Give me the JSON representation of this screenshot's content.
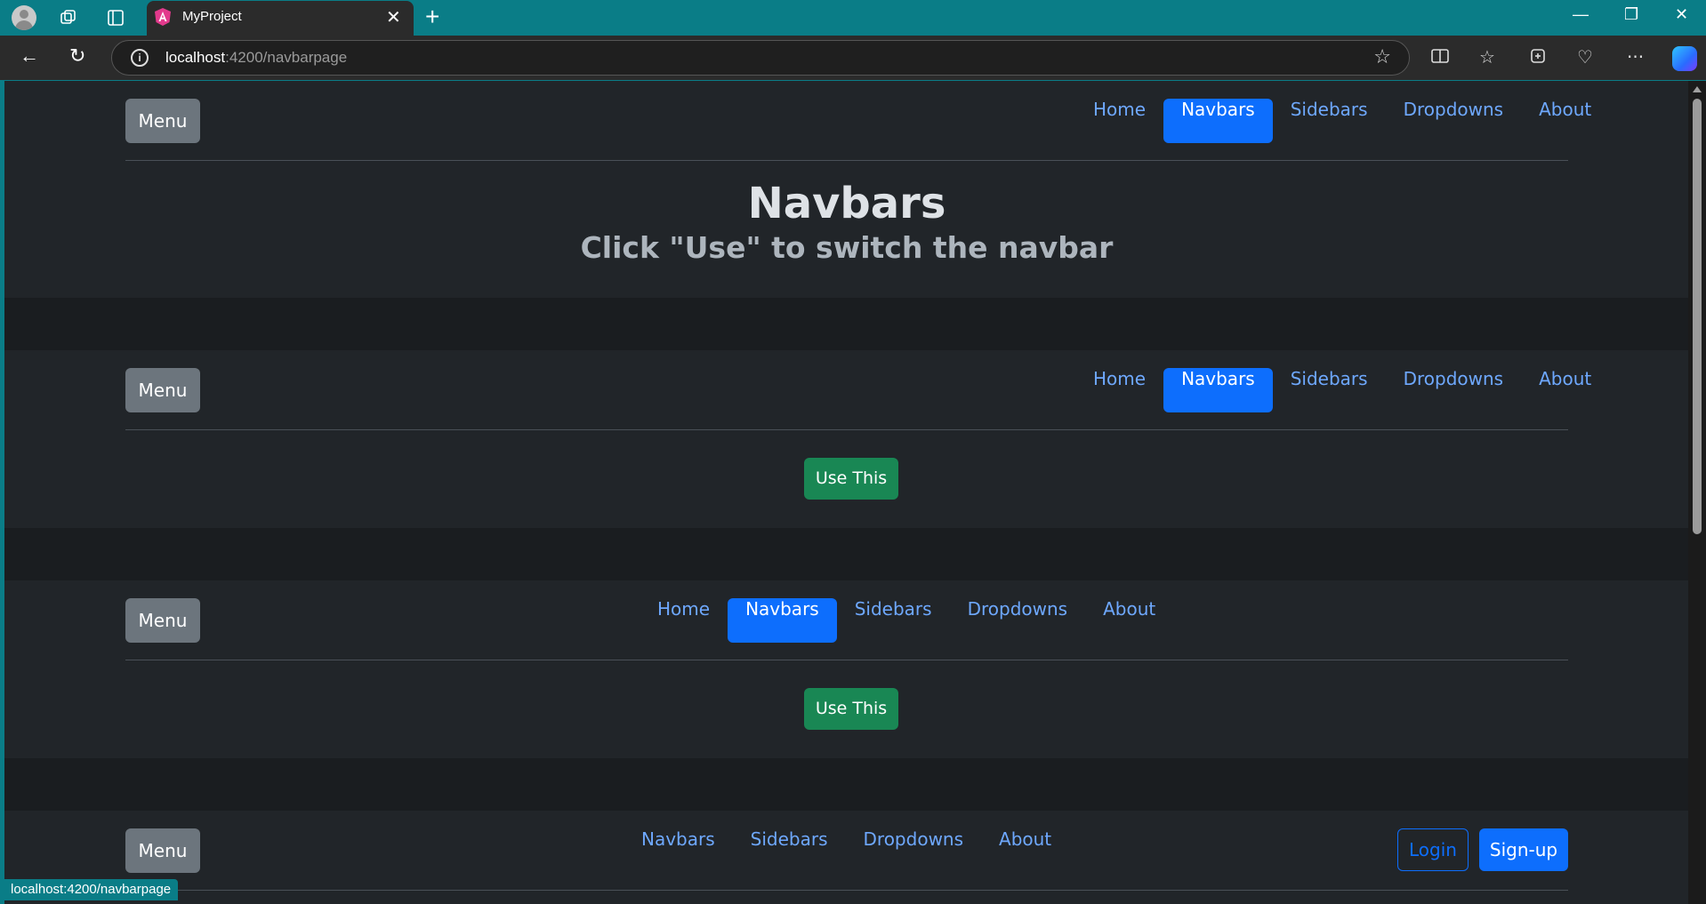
{
  "browser": {
    "tab_title": "MyProject",
    "url_host": "localhost",
    "url_path": ":4200/navbarpage",
    "status_url": "localhost:4200/navbarpage",
    "frame_color": "#0a7d87"
  },
  "hero": {
    "title": "Navbars",
    "subtitle": "Click \"Use\" to switch the navbar"
  },
  "menu_label": "Menu",
  "use_label": "Use This",
  "navbar1": {
    "links": [
      "Home",
      "Navbars",
      "Sidebars",
      "Dropdowns",
      "About"
    ],
    "active": "Navbars"
  },
  "navbar2": {
    "links": [
      "Home",
      "Navbars",
      "Sidebars",
      "Dropdowns",
      "About"
    ],
    "active": "Navbars"
  },
  "navbar3": {
    "links": [
      "Home",
      "Navbars",
      "Sidebars",
      "Dropdowns",
      "About"
    ],
    "active": "Navbars"
  },
  "navbar4": {
    "links": [
      "Navbars",
      "Sidebars",
      "Dropdowns",
      "About"
    ],
    "login_label": "Login",
    "signup_label": "Sign-up"
  },
  "colors": {
    "primary": "#0d6efd",
    "success": "#198754",
    "secondary": "#6c757d",
    "link": "#6ea8fe",
    "bg": "#212529"
  }
}
